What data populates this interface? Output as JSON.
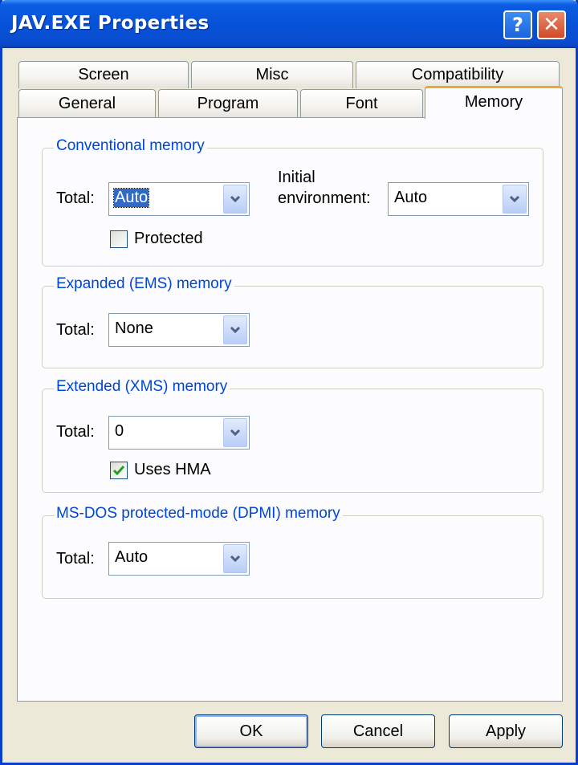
{
  "window": {
    "title": "JAV.EXE Properties"
  },
  "titlebar_buttons": {
    "help_glyph": "?",
    "close_glyph": "✕"
  },
  "tabs": {
    "row1": [
      "Screen",
      "Misc",
      "Compatibility"
    ],
    "row2": [
      "General",
      "Program",
      "Font",
      "Memory"
    ],
    "active": "Memory"
  },
  "conventional": {
    "title": "Conventional memory",
    "total_label": "Total:",
    "total_value": "Auto",
    "initial_env_label_1": "Initial",
    "initial_env_label_2": "environment:",
    "initial_env_value": "Auto",
    "protected_label": "Protected",
    "protected_checked": false
  },
  "ems": {
    "title": "Expanded (EMS) memory",
    "total_label": "Total:",
    "total_value": "None"
  },
  "xms": {
    "title": "Extended (XMS) memory",
    "total_label": "Total:",
    "total_value": "0",
    "hma_label": "Uses HMA",
    "hma_checked": true
  },
  "dpmi": {
    "title": "MS-DOS protected-mode (DPMI) memory",
    "total_label": "Total:",
    "total_value": "Auto"
  },
  "buttons": {
    "ok": "OK",
    "cancel": "Cancel",
    "apply": "Apply"
  },
  "icons": {
    "dropdown": "chevron-down-icon",
    "check": "checkmark-icon",
    "help": "help-icon",
    "close": "close-icon"
  },
  "colors": {
    "titlebar": "#0a4ccf",
    "group_title": "#0046d5",
    "active_tab_accent": "#f1a62d",
    "check_green": "#21a121"
  }
}
